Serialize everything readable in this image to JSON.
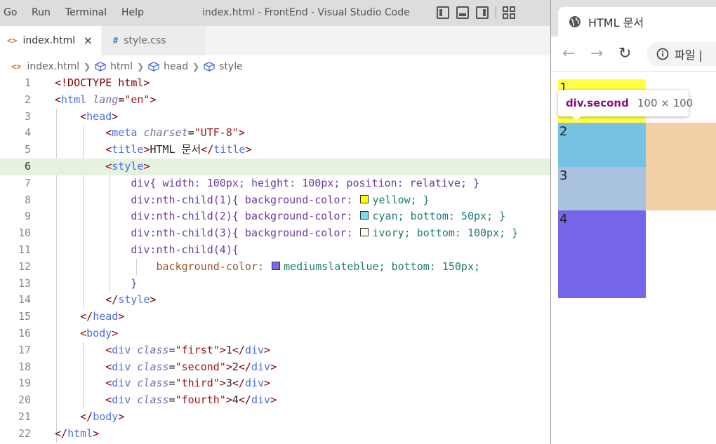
{
  "menu": [
    "Go",
    "Run",
    "Terminal",
    "Help"
  ],
  "window_title": "index.html - FrontEnd - Visual Studio Code",
  "tabs": [
    {
      "label": "index.html",
      "icon": "<>",
      "close": "×"
    },
    {
      "label": "style.css",
      "icon": "#"
    }
  ],
  "breadcrumb": [
    "index.html",
    "html",
    "head",
    "style"
  ],
  "colors": {
    "yellow": "#ffff00",
    "cyan": "#7cd9e7",
    "ivory": "#fffff0",
    "mediumslateblue": "#7b68ee",
    "page_cyan": "#76c1e4",
    "page_ivory": "#a8c2e0",
    "page_slate": "#7565e8",
    "peach": "#f3cfa6",
    "page_yellow": "#ffff44"
  },
  "code": {
    "l1": "<!DOCTYPE html>",
    "l2_tag": "html",
    "l2_attr": "lang",
    "l2_val": "\"en\"",
    "l3_tag": "head",
    "l4_tag": "meta",
    "l4_attr": "charset",
    "l4_val": "\"UTF-8\"",
    "l5_tag": "title",
    "l5_text": "HTML 문서",
    "l6_tag": "style",
    "l7": "div{ width: 100px; height: 100px; position: relative; }",
    "l8a": "div:nth-child(1){ background-color: ",
    "l8b": "yellow; }",
    "l9a": "div:nth-child(2){ background-color: ",
    "l9b": "cyan; bottom: 50px; }",
    "l10a": "div:nth-child(3){ background-color: ",
    "l10b": "ivory; bottom: 100px; }",
    "l11": "div:nth-child(4){",
    "l12a": "background-color: ",
    "l12b": "mediumslateblue; bottom: 150px;",
    "l13": "}",
    "l14_tag": "style",
    "l15_tag": "head",
    "l16_tag": "body",
    "l17_cls": "\"first\"",
    "l17_txt": "1",
    "l18_cls": "\"second\"",
    "l18_txt": "2",
    "l19_cls": "\"third\"",
    "l19_txt": "3",
    "l20_cls": "\"fourth\"",
    "l20_txt": "4",
    "l21_tag": "body",
    "l22_tag": "html",
    "div_tag": "div",
    "class_attr": "class"
  },
  "browser": {
    "tab_title": "HTML 문서",
    "address": "파일 |",
    "tooltip_tag": "div.second",
    "tooltip_size": "100 × 100",
    "boxes": [
      "1",
      "2",
      "3",
      "4"
    ]
  }
}
